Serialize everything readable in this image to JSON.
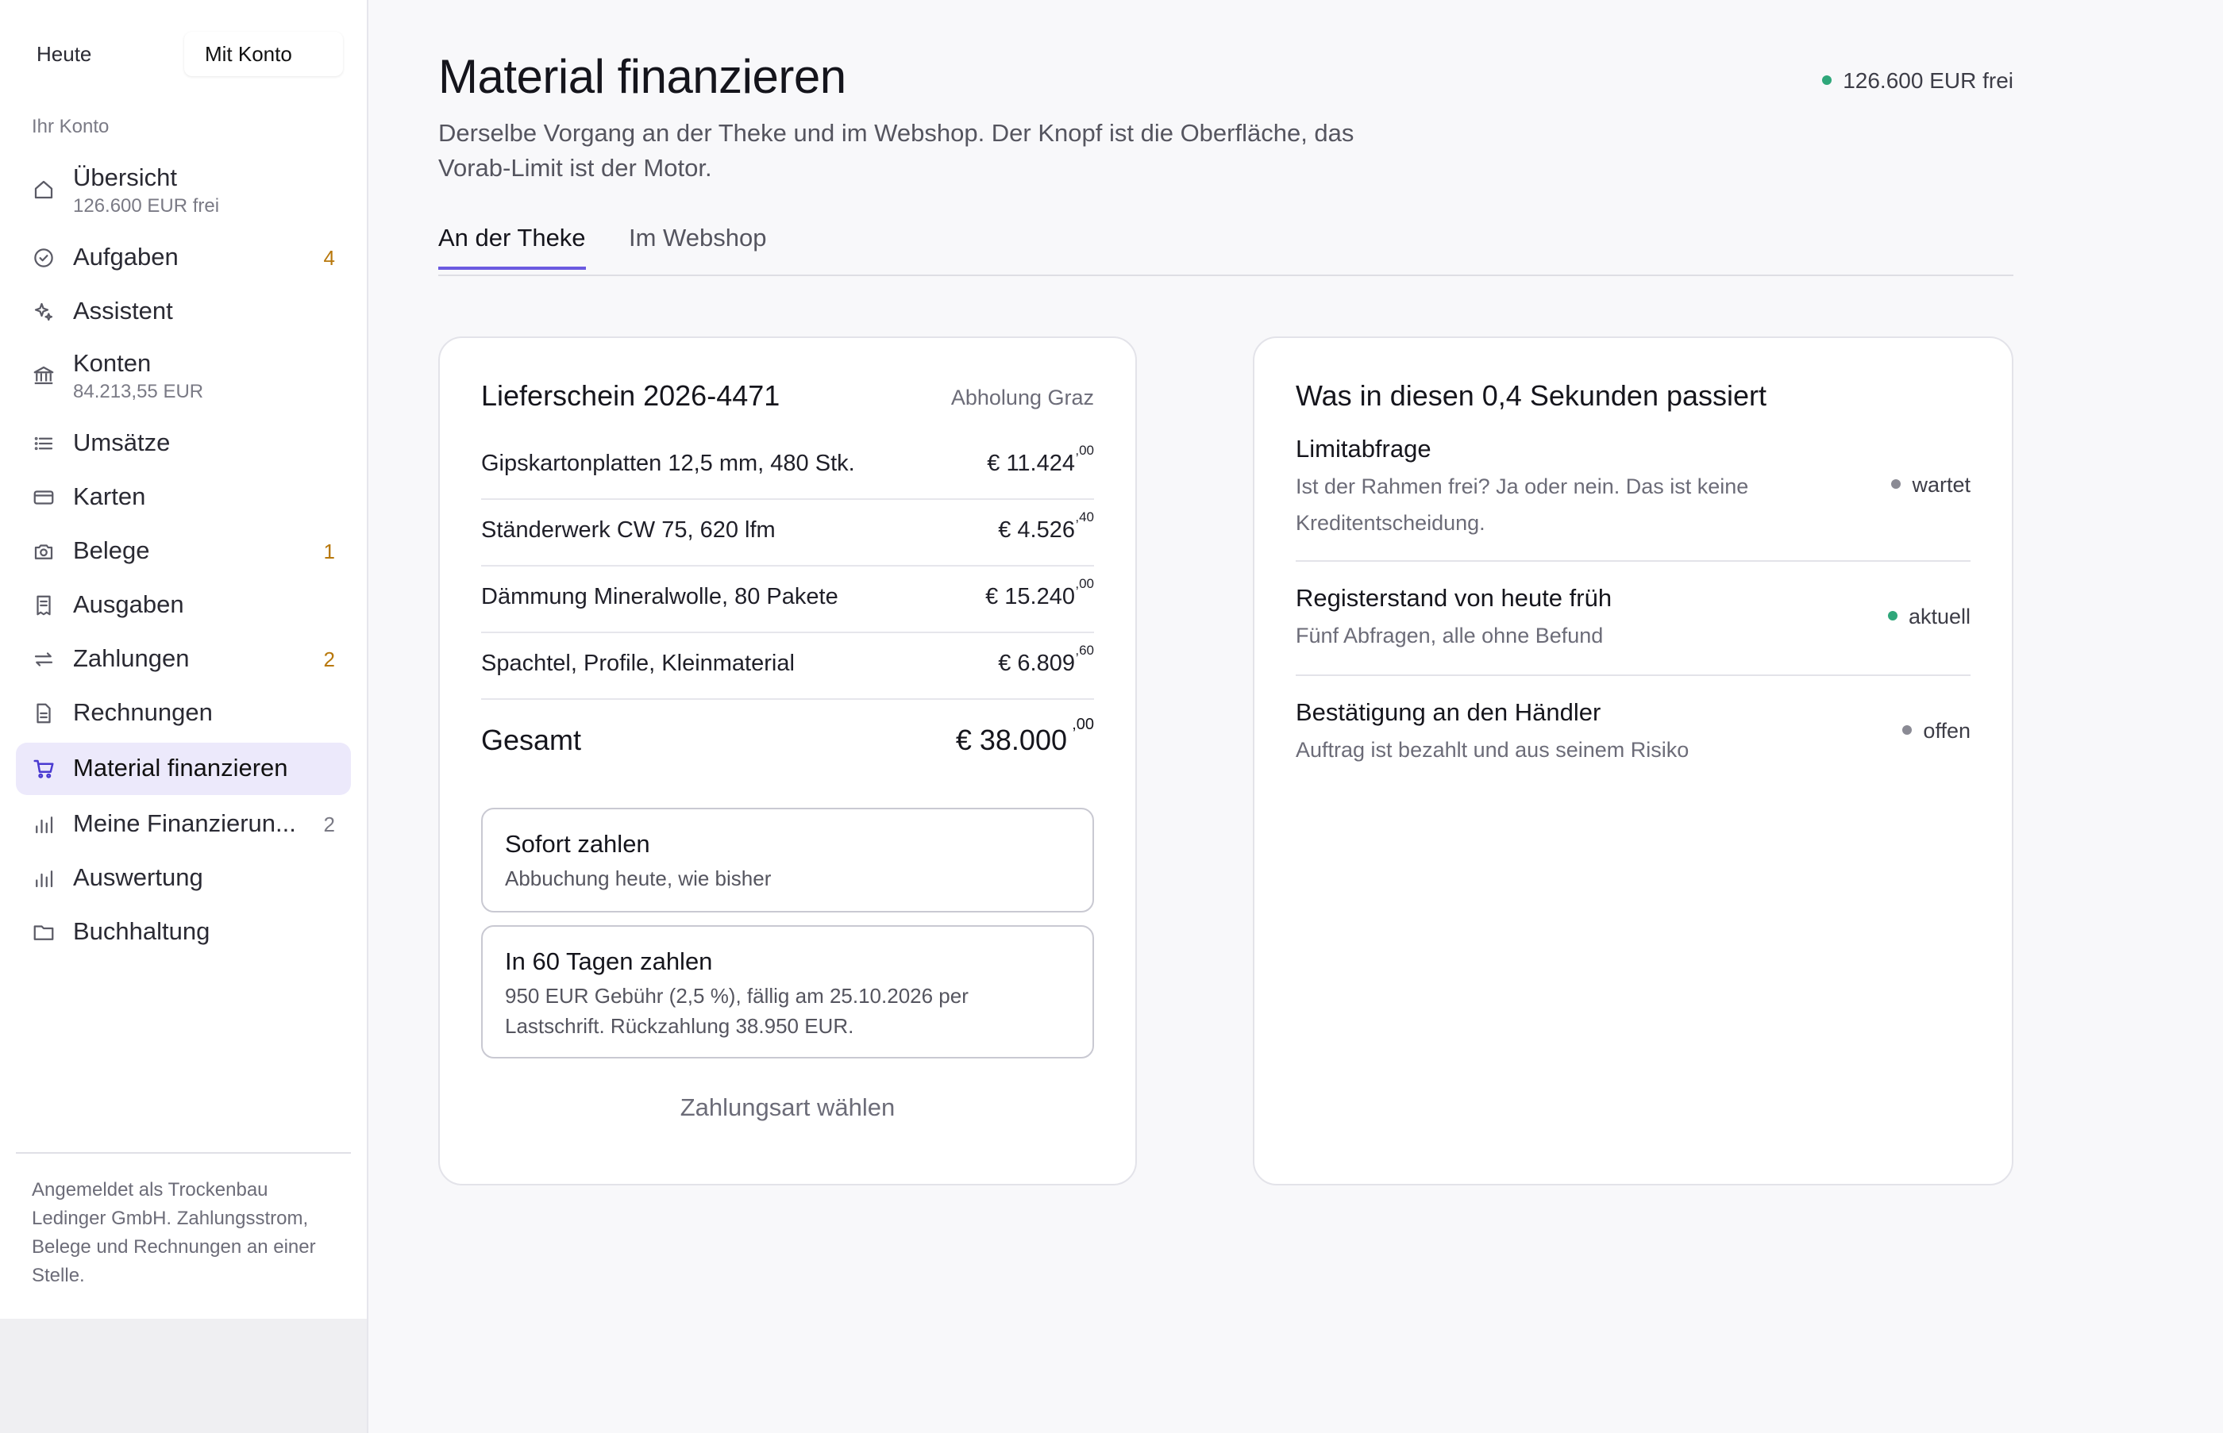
{
  "sidebar": {
    "mode_toggle": {
      "left": "Heute",
      "right": "Mit Konto"
    },
    "section_label": "Ihr Konto",
    "items": [
      {
        "label": "Übersicht",
        "sub": "126.600 EUR frei",
        "badge": "",
        "icon": "home-icon"
      },
      {
        "label": "Aufgaben",
        "sub": "",
        "badge": "4",
        "icon": "check-circle-icon"
      },
      {
        "label": "Assistent",
        "sub": "",
        "badge": "",
        "icon": "sparkle-icon"
      },
      {
        "label": "Konten",
        "sub": "84.213,55 EUR",
        "badge": "",
        "icon": "bank-icon"
      },
      {
        "label": "Umsätze",
        "sub": "",
        "badge": "",
        "icon": "list-icon"
      },
      {
        "label": "Karten",
        "sub": "",
        "badge": "",
        "icon": "card-icon"
      },
      {
        "label": "Belege",
        "sub": "",
        "badge": "1",
        "icon": "camera-icon"
      },
      {
        "label": "Ausgaben",
        "sub": "",
        "badge": "",
        "icon": "receipt-icon"
      },
      {
        "label": "Zahlungen",
        "sub": "",
        "badge": "2",
        "icon": "transfer-icon"
      },
      {
        "label": "Rechnungen",
        "sub": "",
        "badge": "",
        "icon": "document-icon"
      },
      {
        "label": "Material finanzieren",
        "sub": "",
        "badge": "",
        "icon": "cart-icon",
        "active": true
      },
      {
        "label": "Meine Finanzierun...",
        "sub": "",
        "badge": "2",
        "icon": "bar-chart-icon"
      },
      {
        "label": "Auswertung",
        "sub": "",
        "badge": "",
        "icon": "bar-chart-icon"
      },
      {
        "label": "Buchhaltung",
        "sub": "",
        "badge": "",
        "icon": "folder-icon"
      }
    ],
    "footer": "Angemeldet als Trockenbau Ledinger GmbH. Zahlungsstrom, Belege und Rechnungen an einer Stelle."
  },
  "header": {
    "title": "Material finanzieren",
    "description": "Derselbe Vorgang an der Theke und im Webshop. Der Knopf ist die Oberfläche, das Vorab-Limit ist der Motor.",
    "limit": "126.600 EUR frei"
  },
  "tabs": [
    {
      "label": "An der Theke",
      "active": true
    },
    {
      "label": "Im Webshop",
      "active": false
    }
  ],
  "delivery": {
    "title": "Lieferschein 2026-4471",
    "meta": "Abholung Graz",
    "items": [
      {
        "desc": "Gipskartonplatten 12,5 mm, 480 Stk.",
        "amount": "€ 11.424",
        "cents": ",00"
      },
      {
        "desc": "Ständerwerk CW 75, 620 lfm",
        "amount": "€ 4.526",
        "cents": ",40"
      },
      {
        "desc": "Dämmung Mineralwolle, 80 Pakete",
        "amount": "€ 15.240",
        "cents": ",00"
      },
      {
        "desc": "Spachtel, Profile, Kleinmaterial",
        "amount": "€ 6.809",
        "cents": ",60"
      }
    ],
    "total": {
      "label": "Gesamt",
      "amount": "€ 38.000",
      "cents": ",00"
    },
    "options": [
      {
        "title": "Sofort zahlen",
        "desc": "Abbuchung heute, wie bisher"
      },
      {
        "title": "In 60 Tagen zahlen",
        "desc": "950 EUR Gebühr (2,5 %), fällig am 25.10.2026 per Lastschrift. Rückzahlung 38.950 EUR."
      }
    ],
    "choose_label": "Zahlungsart wählen"
  },
  "process": {
    "title": "Was in diesen 0,4 Sekunden passiert",
    "steps": [
      {
        "title": "Limitabfrage",
        "desc": "Ist der Rahmen frei? Ja oder nein. Das ist keine Kreditentscheidung.",
        "status": "wartet",
        "status_color": "#8a8a94"
      },
      {
        "title": "Registerstand von heute früh",
        "desc": "Fünf Abfragen, alle ohne Befund",
        "status": "aktuell",
        "status_color": "#2fa77a"
      },
      {
        "title": "Bestätigung an den Händler",
        "desc": "Auftrag ist bezahlt und aus seinem Risiko",
        "status": "offen",
        "status_color": "#8a8a94"
      }
    ]
  },
  "colors": {
    "accent": "#6b5ae0",
    "active_bg": "#ece9fb",
    "badge": "#b8780c",
    "success": "#2fa77a"
  }
}
